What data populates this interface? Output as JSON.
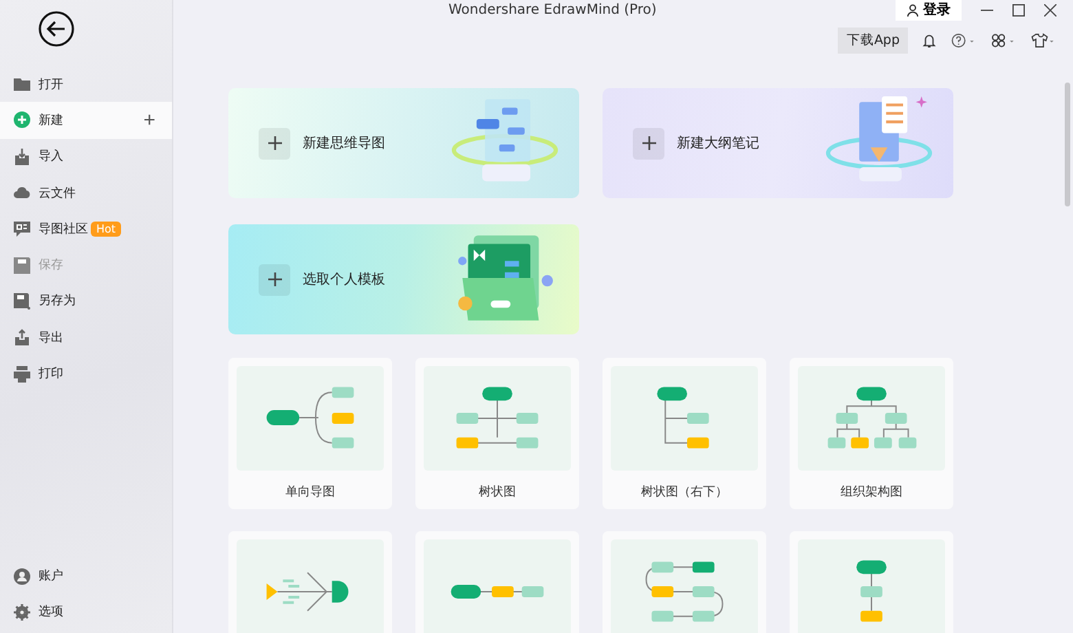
{
  "window": {
    "title": "Wondershare EdrawMind (Pro)",
    "login_button": "登录"
  },
  "toolbar": {
    "download_button": "下载App"
  },
  "sidebar": {
    "items": [
      {
        "label": "打开",
        "selected": false,
        "disabled": false
      },
      {
        "label": "新建",
        "selected": true,
        "disabled": false,
        "add_button": "+"
      },
      {
        "label": "导入",
        "selected": false,
        "disabled": false
      },
      {
        "label": "云文件",
        "selected": false,
        "disabled": false
      },
      {
        "label": "导图社区",
        "selected": false,
        "disabled": false,
        "badge": "Hot"
      },
      {
        "label": "保存",
        "selected": false,
        "disabled": true
      },
      {
        "label": "另存为",
        "selected": false,
        "disabled": false
      },
      {
        "label": "导出",
        "selected": false,
        "disabled": false
      },
      {
        "label": "打印",
        "selected": false,
        "disabled": false
      }
    ],
    "bottom_items": [
      {
        "label": "账户"
      },
      {
        "label": "选项"
      }
    ]
  },
  "create_cards": [
    {
      "label": "新建思维导图",
      "kind": "mindmap"
    },
    {
      "label": "新建大纲笔记",
      "kind": "outline"
    },
    {
      "label": "选取个人模板",
      "kind": "template"
    }
  ],
  "templates": [
    {
      "label": "单向导图",
      "kind": "one-way"
    },
    {
      "label": "树状图",
      "kind": "tree"
    },
    {
      "label": "树状图（右下）",
      "kind": "tree-right"
    },
    {
      "label": "组织架构图",
      "kind": "org"
    },
    {
      "kind": "fishbone"
    },
    {
      "kind": "timeline"
    },
    {
      "kind": "serpentine"
    },
    {
      "kind": "vertical"
    }
  ]
}
